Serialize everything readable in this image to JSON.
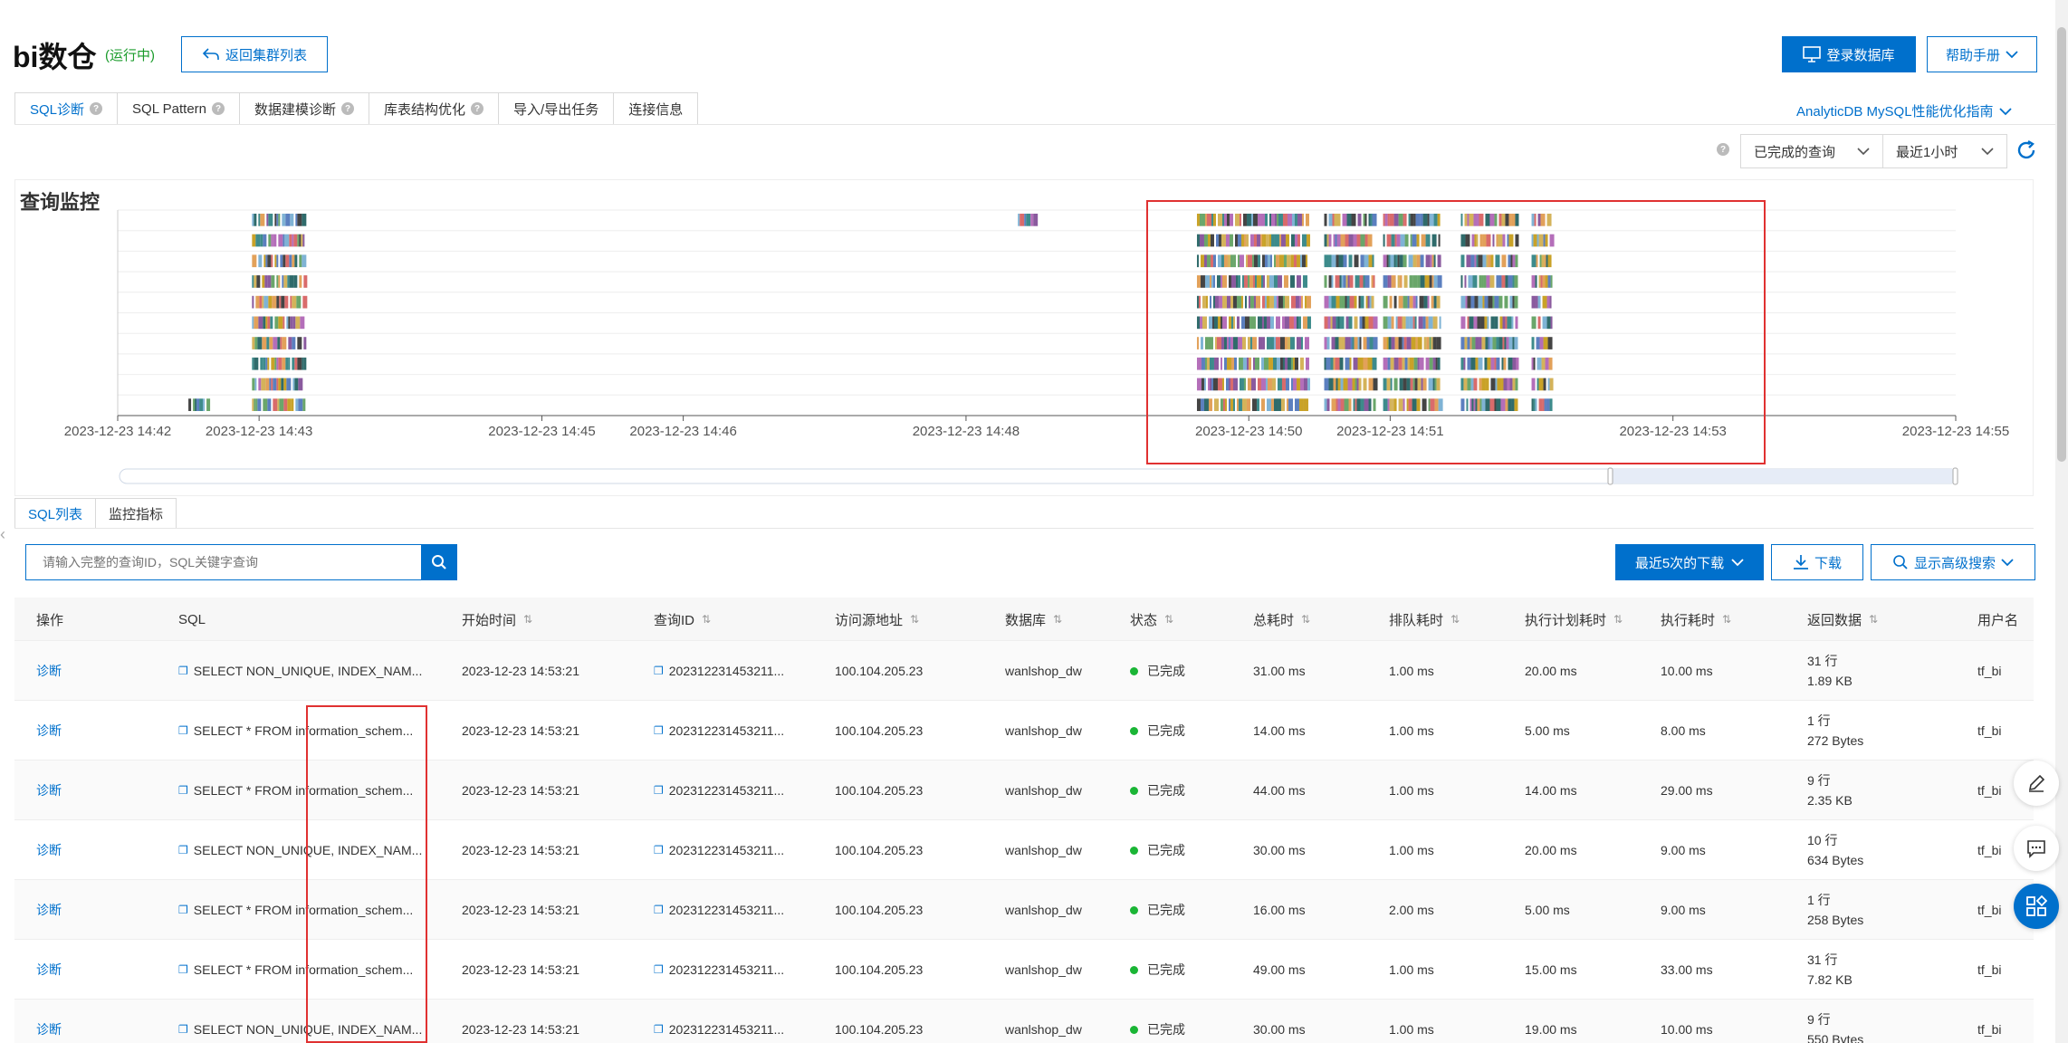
{
  "header": {
    "title": "bi数仓",
    "status": "(运行中)",
    "back_label": "返回集群列表",
    "login_label": "登录数据库",
    "help_label": "帮助手册"
  },
  "tabs": [
    {
      "label": "SQL诊断",
      "help": true,
      "active": true
    },
    {
      "label": "SQL Pattern",
      "help": true
    },
    {
      "label": "数据建模诊断",
      "help": true
    },
    {
      "label": "库表结构优化",
      "help": true
    },
    {
      "label": "导入/导出任务",
      "help": false
    },
    {
      "label": "连接信息",
      "help": false
    }
  ],
  "guide_link": "AnalyticDB MySQL性能优化指南",
  "filter": {
    "status_value": "已完成的查询",
    "range_value": "最近1小时"
  },
  "chart": {
    "title": "查询监控",
    "highlight_color": "#e03131"
  },
  "chart_data": {
    "type": "scatter",
    "title": "查询监控",
    "x_ticks": [
      "2023-12-23 14:42",
      "2023-12-23 14:43",
      "2023-12-23 14:45",
      "2023-12-23 14:46",
      "2023-12-23 14:48",
      "2023-12-23 14:50",
      "2023-12-23 14:51",
      "2023-12-23 14:53",
      "2023-12-23 14:55"
    ],
    "grid": true,
    "series": [
      {
        "start": "2023-12-23 14:42:30",
        "end": "2023-12-23 14:42:30",
        "y_levels": [
          1
        ]
      },
      {
        "start": "2023-12-23 14:42:57",
        "end": "2023-12-23 14:43:19",
        "y_levels": [
          1,
          2,
          3,
          4,
          5,
          6,
          7,
          8,
          9,
          10
        ]
      },
      {
        "start": "2023-12-23 14:48:22",
        "end": "2023-12-23 14:48:26",
        "y_levels": [
          10
        ]
      },
      {
        "start": "2023-12-23 14:49:38",
        "end": "2023-12-23 14:50:25",
        "y_levels": [
          1,
          2,
          3,
          4,
          5,
          6,
          7,
          8,
          9,
          10
        ]
      },
      {
        "start": "2023-12-23 14:50:32",
        "end": "2023-12-23 14:50:53",
        "y_levels": [
          1,
          2,
          3,
          4,
          5,
          6,
          7,
          8,
          9,
          10
        ]
      },
      {
        "start": "2023-12-23 14:50:57",
        "end": "2023-12-23 14:51:21",
        "y_levels": [
          1,
          2,
          3,
          4,
          5,
          6,
          7,
          8,
          9,
          10
        ]
      },
      {
        "start": "2023-12-23 14:51:30",
        "end": "2023-12-23 14:51:54",
        "y_levels": [
          1,
          2,
          3,
          4,
          5,
          6,
          7,
          8,
          9,
          10
        ]
      },
      {
        "start": "2023-12-23 14:52:00",
        "end": "2023-12-23 14:52:06",
        "y_levels": [
          1,
          2,
          3,
          4,
          5,
          6,
          7,
          8,
          9,
          10
        ]
      }
    ]
  },
  "subtabs": [
    {
      "label": "SQL列表",
      "active": true
    },
    {
      "label": "监控指标"
    }
  ],
  "search": {
    "placeholder": "请输入完整的查询ID，SQL关键字查询"
  },
  "actions": {
    "recent_label": "最近5次的下载",
    "download_label": "下载",
    "advanced_label": "显示高级搜索"
  },
  "table": {
    "columns": [
      "操作",
      "SQL",
      "开始时间",
      "查询ID",
      "访问源地址",
      "数据库",
      "状态",
      "总耗时",
      "排队耗时",
      "执行计划耗时",
      "执行耗时",
      "返回数据",
      "用户名"
    ],
    "rows": [
      {
        "action": "诊断",
        "sql": "SELECT NON_UNIQUE, INDEX_NAM...",
        "start": "2023-12-23 14:53:21",
        "qid": "202312231453211...",
        "src": "100.104.205.23",
        "db": "wanlshop_dw",
        "status": "已完成",
        "total": "31.00 ms",
        "queue": "1.00 ms",
        "plan": "20.00 ms",
        "exec": "10.00 ms",
        "rows": "31 行",
        "size": "1.89 KB",
        "user": "tf_bi"
      },
      {
        "action": "诊断",
        "sql": "SELECT * FROM information_schem...",
        "start": "2023-12-23 14:53:21",
        "qid": "202312231453211...",
        "src": "100.104.205.23",
        "db": "wanlshop_dw",
        "status": "已完成",
        "total": "14.00 ms",
        "queue": "1.00 ms",
        "plan": "5.00 ms",
        "exec": "8.00 ms",
        "rows": "1 行",
        "size": "272 Bytes",
        "user": "tf_bi"
      },
      {
        "action": "诊断",
        "sql": "SELECT * FROM information_schem...",
        "start": "2023-12-23 14:53:21",
        "qid": "202312231453211...",
        "src": "100.104.205.23",
        "db": "wanlshop_dw",
        "status": "已完成",
        "total": "44.00 ms",
        "queue": "1.00 ms",
        "plan": "14.00 ms",
        "exec": "29.00 ms",
        "rows": "9 行",
        "size": "2.35 KB",
        "user": "tf_bi"
      },
      {
        "action": "诊断",
        "sql": "SELECT NON_UNIQUE, INDEX_NAM...",
        "start": "2023-12-23 14:53:21",
        "qid": "202312231453211...",
        "src": "100.104.205.23",
        "db": "wanlshop_dw",
        "status": "已完成",
        "total": "30.00 ms",
        "queue": "1.00 ms",
        "plan": "20.00 ms",
        "exec": "9.00 ms",
        "rows": "10 行",
        "size": "634 Bytes",
        "user": "tf_bi"
      },
      {
        "action": "诊断",
        "sql": "SELECT * FROM information_schem...",
        "start": "2023-12-23 14:53:21",
        "qid": "202312231453211...",
        "src": "100.104.205.23",
        "db": "wanlshop_dw",
        "status": "已完成",
        "total": "16.00 ms",
        "queue": "2.00 ms",
        "plan": "5.00 ms",
        "exec": "9.00 ms",
        "rows": "1 行",
        "size": "258 Bytes",
        "user": "tf_bi"
      },
      {
        "action": "诊断",
        "sql": "SELECT * FROM information_schem...",
        "start": "2023-12-23 14:53:21",
        "qid": "202312231453211...",
        "src": "100.104.205.23",
        "db": "wanlshop_dw",
        "status": "已完成",
        "total": "49.00 ms",
        "queue": "1.00 ms",
        "plan": "15.00 ms",
        "exec": "33.00 ms",
        "rows": "31 行",
        "size": "7.82 KB",
        "user": "tf_bi"
      },
      {
        "action": "诊断",
        "sql": "SELECT NON_UNIQUE, INDEX_NAM...",
        "start": "2023-12-23 14:53:21",
        "qid": "202312231453211...",
        "src": "100.104.205.23",
        "db": "wanlshop_dw",
        "status": "已完成",
        "total": "30.00 ms",
        "queue": "1.00 ms",
        "plan": "19.00 ms",
        "exec": "10.00 ms",
        "rows": "9 行",
        "size": "550 Bytes",
        "user": "tf_bi"
      }
    ]
  },
  "colors": {
    "primary": "#0070cc",
    "success": "#1ab535",
    "running": "#1a9b2b"
  },
  "icons": [
    "back-arrow-icon",
    "monitor-icon",
    "chevron-down-icon",
    "help-icon",
    "refresh-icon",
    "search-icon",
    "download-icon",
    "copy-icon",
    "edit-icon",
    "chat-icon",
    "apps-icon"
  ]
}
